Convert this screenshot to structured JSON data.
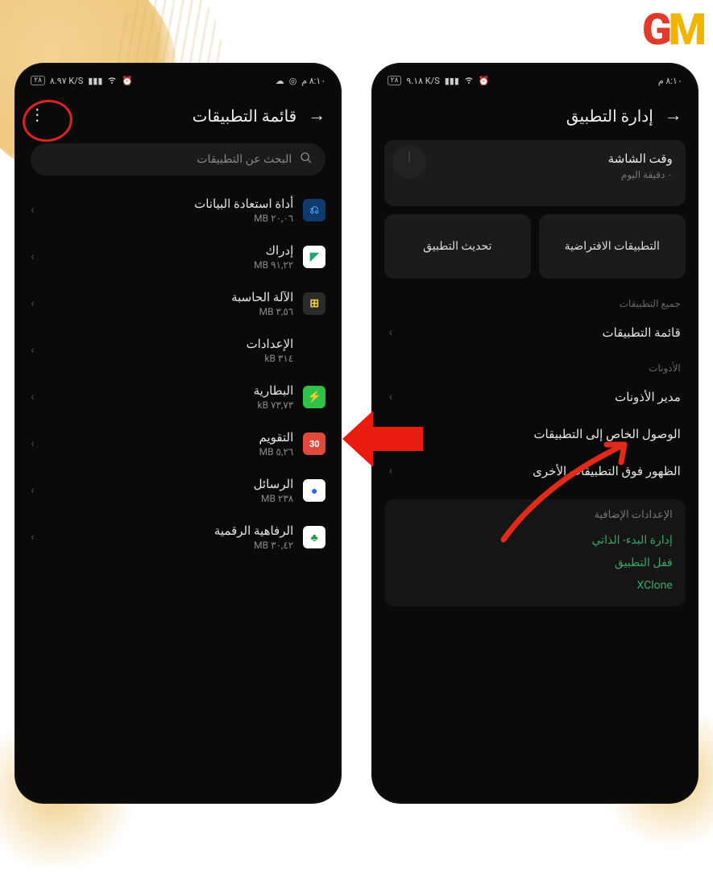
{
  "logo": {
    "g": "G",
    "m": "M"
  },
  "left_phone": {
    "status": {
      "time": "٨:١٠ م",
      "net": "٨.٩٧ K/S",
      "battery": "٢٨"
    },
    "title": "قائمة التطبيقات",
    "search": {
      "placeholder": "البحث عن التطبيقات"
    },
    "apps": [
      {
        "name": "أداة استعادة البيانات",
        "size": "٢٠,٠٦ MB",
        "icon_bg": "#0f3a6a",
        "icon_fg": "#4aa3ff",
        "glyph": "⎌"
      },
      {
        "name": "إدراك",
        "size": "٩١,٢٢ MB",
        "icon_bg": "#fff",
        "icon_fg": "#1aa874",
        "glyph": "◤"
      },
      {
        "name": "الآلة الحاسبة",
        "size": "٣,٥٦ MB",
        "icon_bg": "#2a2a2a",
        "icon_fg": "#f2c94c",
        "glyph": "⊞"
      },
      {
        "name": "الإعدادات",
        "size": "٣١٤ kB",
        "icon_bg": "",
        "icon_fg": "",
        "glyph": ""
      },
      {
        "name": "البطارية",
        "size": "٧٣,٧٣ kB",
        "icon_bg": "#2ec24a",
        "icon_fg": "#fff",
        "glyph": "⚡"
      },
      {
        "name": "التقويم",
        "size": "٥,٢٦ MB",
        "icon_bg": "#e04a3a",
        "icon_fg": "#fff",
        "glyph": "30"
      },
      {
        "name": "الرسائل",
        "size": "٢٣٨ MB",
        "icon_bg": "#fff",
        "icon_fg": "#2a6af0",
        "glyph": "●"
      },
      {
        "name": "الرفاهية الرقمية",
        "size": "٣٠,٤٢ MB",
        "icon_bg": "#fff",
        "icon_fg": "#2a9a4a",
        "glyph": "♣"
      }
    ]
  },
  "right_phone": {
    "status": {
      "time": "٨:١٠ م",
      "net": "٩.١٨ K/S",
      "battery": "٢٨"
    },
    "title": "إدارة التطبيق",
    "screen_time": {
      "title": "وقت الشاشة",
      "sub": "٠ دقيقة اليوم"
    },
    "card_default": "التطبيقات الافتراضية",
    "card_update": "تحديث التطبيق",
    "section_all": "جميع التطبيقات",
    "row_app_list": "قائمة التطبيقات",
    "section_perm": "الأذونات",
    "row_perm_mgr": "مدير الأذونات",
    "row_special": "الوصول الخاص إلى التطبيقات",
    "row_overlay": "الظهور فوق التطبيقات الأخرى",
    "extra": {
      "title": "الإعدادات الإضافية",
      "auto_start": "إدارة البدء- الذاتي",
      "app_lock": "قفل التطبيق",
      "xclone": "XClone"
    }
  }
}
